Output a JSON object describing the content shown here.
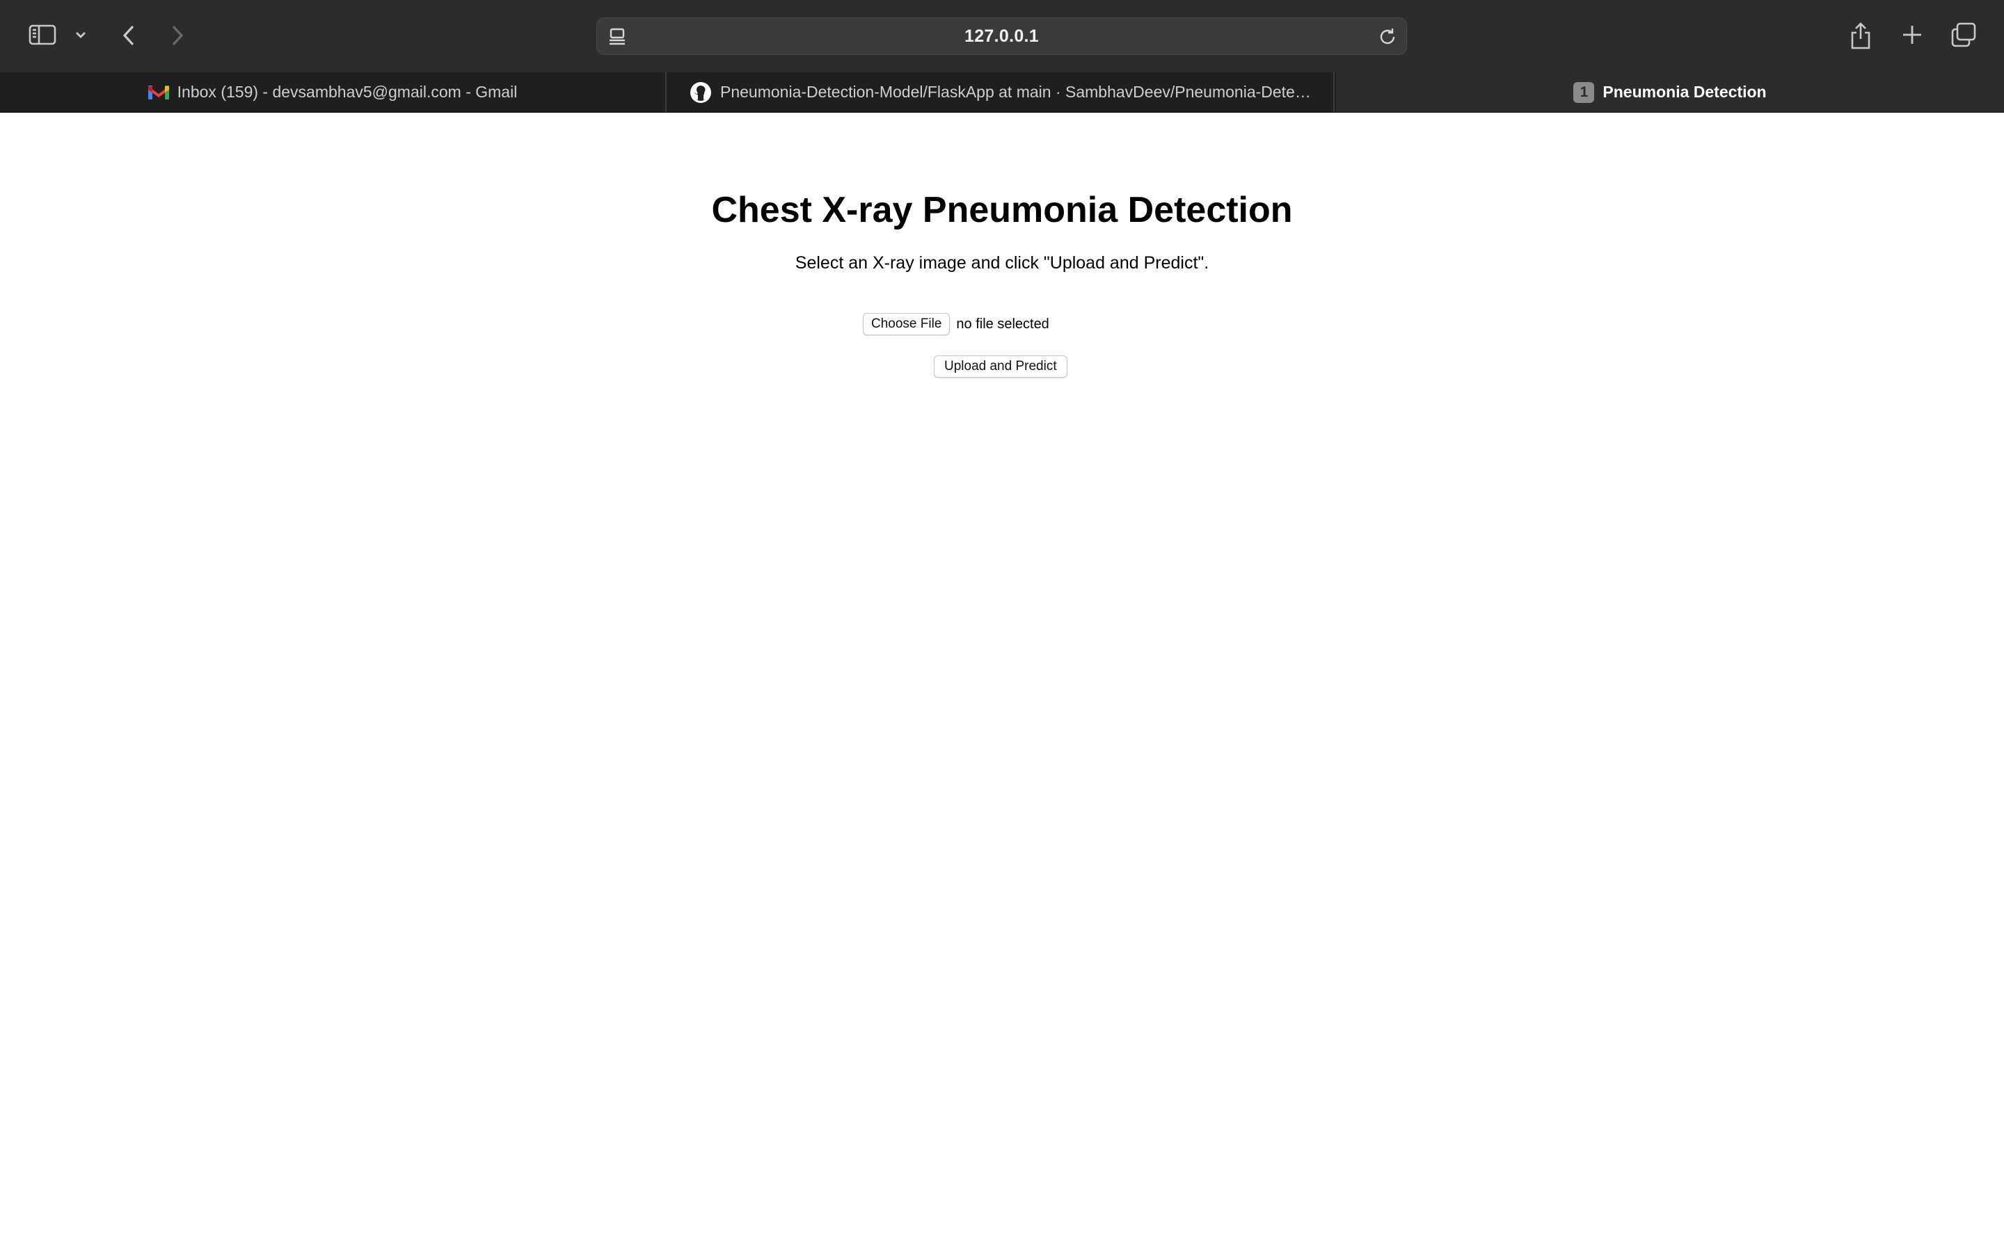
{
  "browser": {
    "address": "127.0.0.1",
    "icons": {
      "sidebar": "sidebar-icon",
      "sidebar_menu": "chevron-down-icon",
      "back": "chevron-left-icon",
      "forward": "chevron-right-icon",
      "reader": "reader-icon",
      "reload": "reload-icon",
      "share": "share-icon",
      "new_tab": "plus-icon",
      "tab_overview": "tab-overview-icon"
    },
    "tabs": [
      {
        "label": "Inbox (159) - devsambhav5@gmail.com - Gmail",
        "icon": "gmail-icon",
        "active": false
      },
      {
        "label": "Pneumonia-Detection-Model/FlaskApp at main · SambhavDeev/Pneumonia-Detec...",
        "icon": "github-icon",
        "active": false
      },
      {
        "label": "Pneumonia Detection",
        "badge": "1",
        "active": true
      }
    ]
  },
  "page": {
    "title": "Chest X-ray Pneumonia Detection",
    "subtitle": "Select an X-ray image and click \"Upload and Predict\".",
    "choose_file_label": "Choose File",
    "file_status": "no file selected",
    "upload_label": "Upload and Predict"
  },
  "colors": {
    "toolbar": "#2c2c2c",
    "tabstrip": "#1f1f1f",
    "active_tab": "#2c2c2c",
    "page_background": "#ffffff"
  }
}
